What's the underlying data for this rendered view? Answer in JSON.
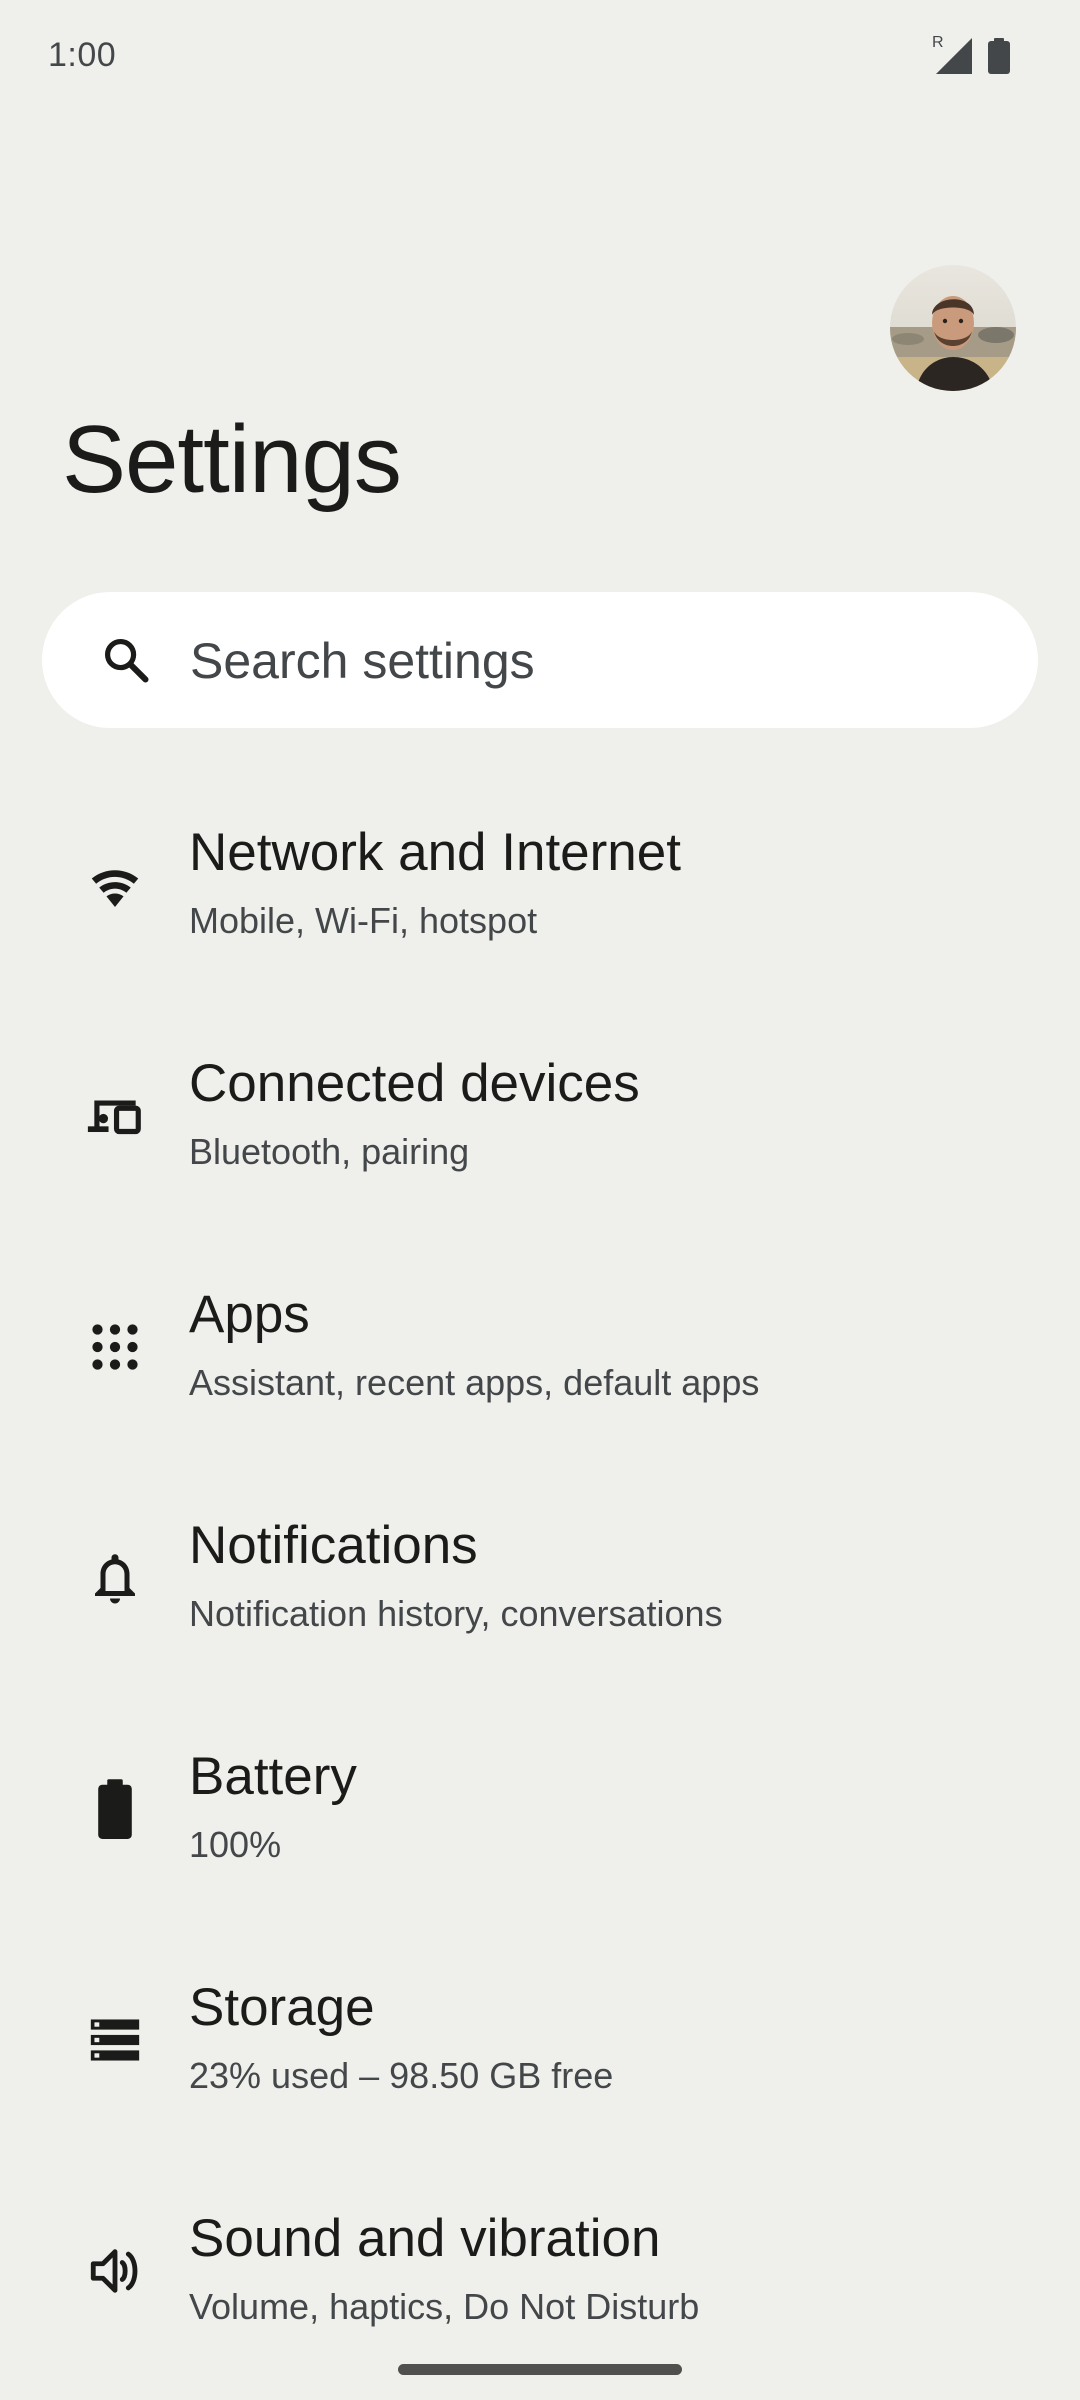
{
  "status_bar": {
    "time": "1:00",
    "roaming_indicator": "R",
    "icons": [
      "signal-icon",
      "battery-icon"
    ]
  },
  "header": {
    "title": "Settings",
    "avatar": "profile-avatar"
  },
  "search": {
    "placeholder": "Search settings",
    "icon": "search-icon"
  },
  "settings": {
    "items": [
      {
        "icon": "wifi-icon",
        "title": "Network and Internet",
        "subtitle": "Mobile, Wi-Fi, hotspot"
      },
      {
        "icon": "connected-devices-icon",
        "title": "Connected devices",
        "subtitle": "Bluetooth, pairing"
      },
      {
        "icon": "apps-grid-icon",
        "title": "Apps",
        "subtitle": "Assistant, recent apps, default apps"
      },
      {
        "icon": "bell-icon",
        "title": "Notifications",
        "subtitle": "Notification history, conversations"
      },
      {
        "icon": "battery-icon",
        "title": "Battery",
        "subtitle": "100%"
      },
      {
        "icon": "storage-icon",
        "title": "Storage",
        "subtitle": "23% used – 98.50 GB free"
      },
      {
        "icon": "volume-icon",
        "title": "Sound and vibration",
        "subtitle": "Volume, haptics, Do Not Disturb"
      }
    ]
  },
  "colors": {
    "background": "#eff0ec",
    "search_background": "#ffffff",
    "primary_text": "#1b1c1a",
    "secondary_text": "#44474a"
  }
}
